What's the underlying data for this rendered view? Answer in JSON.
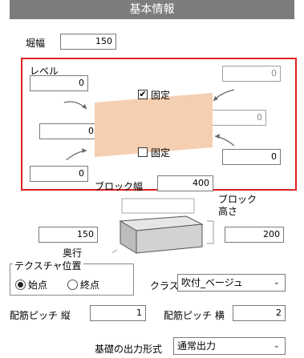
{
  "header": {
    "title": "基本情報"
  },
  "width": {
    "label": "堀幅",
    "value": "150"
  },
  "level": {
    "label": "レベル",
    "top_left": "0",
    "top_right": "0",
    "mid_left": "0",
    "mid_right": "0",
    "bottom_left": "0",
    "bottom_right": "0",
    "fixed_top_label": "固定",
    "fixed_top_checked": "✔",
    "fixed_bottom_label": "固定",
    "block_width_label": "ブロック幅",
    "block_width_value": "400"
  },
  "block": {
    "height_label": "ブロック\n高さ",
    "height_value": "200",
    "depth_label": "奥行",
    "depth_value": "150"
  },
  "texture": {
    "group_label": "テクスチャ位置",
    "start_label": "始点",
    "end_label": "終点",
    "selected": "start"
  },
  "class": {
    "label": "クラス",
    "value": "吹付_ベージュ"
  },
  "pitch": {
    "vertical_label": "配筋ピッチ 縦",
    "vertical_value": "1",
    "horizontal_label": "配筋ピッチ 横",
    "horizontal_value": "2"
  },
  "output": {
    "label": "基礎の出力形式",
    "value": "通常出力"
  },
  "colors": {
    "accent_red": "#e02020",
    "header_gray": "#7d7d7d",
    "block_fill": "#f5cfb2"
  }
}
